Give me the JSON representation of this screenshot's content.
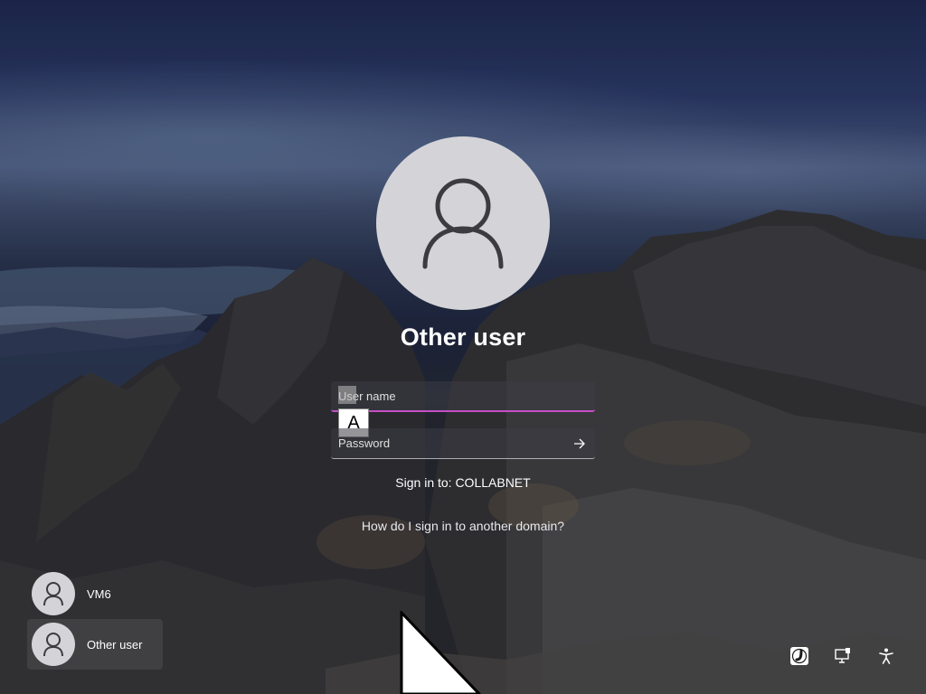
{
  "account": {
    "display_name": "Other user",
    "avatar_icon": "person-icon"
  },
  "form": {
    "username_placeholder": "User name",
    "username_value": "",
    "password_placeholder": "Password",
    "password_value": "",
    "ime_mode": "A",
    "submit_icon": "arrow-right-icon"
  },
  "domain": {
    "sign_in_to": "Sign in to: COLLABNET",
    "other_domain_link": "How do I sign in to another domain?"
  },
  "user_list": [
    {
      "label": "VM6",
      "selected": false
    },
    {
      "label": "Other user",
      "selected": true
    }
  ],
  "tray": [
    {
      "icon": "network-icon"
    },
    {
      "icon": "remote-desktop-icon"
    },
    {
      "icon": "accessibility-icon"
    }
  ],
  "colors": {
    "focus_underline": "#c64fc6",
    "avatar_bg": "#d4d4d8"
  }
}
